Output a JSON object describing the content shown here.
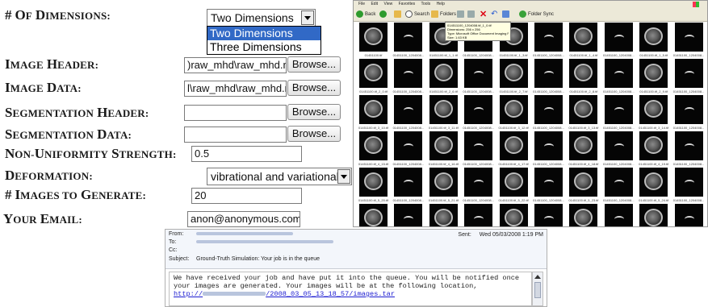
{
  "form": {
    "dimensions": {
      "label": "# of Dimensions:",
      "selected": "Two Dimensions",
      "options": [
        "Two Dimensions",
        "Three Dimensions"
      ]
    },
    "image_header": {
      "label": "Image Header:",
      "value": ")raw_mhd\\raw_mhd.mhd",
      "button": "Browse..."
    },
    "image_data": {
      "label": "Image Data:",
      "value": "l\\raw_mhd\\raw_mhd.raw",
      "button": "Browse..."
    },
    "segmentation_header": {
      "label": "Segmentation Header:",
      "value": "",
      "button": "Browse..."
    },
    "segmentation_data": {
      "label": "Segmentation Data:",
      "value": "",
      "button": "Browse..."
    },
    "non_uniformity": {
      "label": "Non-Uniformity Strength:",
      "value": "0.5"
    },
    "deformation": {
      "label": "Deformation:",
      "selected": "vibrational and variational"
    },
    "num_images": {
      "label": "# Images to Generate:",
      "value": "20"
    },
    "email": {
      "label": "Your Email:",
      "value": "anon@anonymous.com"
    }
  },
  "explorer": {
    "menu": [
      "File",
      "Edit",
      "View",
      "Favorites",
      "Tools",
      "Help"
    ],
    "toolbar": {
      "back": "Back",
      "search": "Search",
      "folders": "Folders",
      "folder_sync": "Folder Sync"
    },
    "tooltip": [
      "014511100_1204008.tif_1_0.tif",
      "Dimensions: 256 x 256",
      "Type: Microsoft Office Document Imaging File",
      "Size: 1.63 KB"
    ],
    "captions": [
      [
        "01451100.tif",
        "01451100_1204008...",
        "01451100.tif_1_1.tif",
        "01451100_1204008...",
        "01451100.tif_1_3.tif",
        "01451100_1204008...",
        "01451100.tif_1_4.tif",
        "01451100_1204008...",
        "01451100.tif_1_5.tif",
        "01451100_1204008..."
      ],
      [
        "01451100.tif_2_0.tif",
        "01451100_1204008...",
        "01451100.tif_2_6.tif",
        "01451100_1204008...",
        "01451100.tif_2_7.tif",
        "01451100_1204008...",
        "01451100.tif_2_8.tif",
        "01451100_1204008...",
        "01451100.tif_2_9.tif",
        "01451100_1204008..."
      ],
      [
        "01451100.tif_3_10.tif",
        "01451100_1204008...",
        "01451100.tif_3_11.tif",
        "01451100_1204008...",
        "01451100.tif_3_12.tif",
        "01451100_1204008...",
        "01451100.tif_3_13.tif",
        "01451100_1204008...",
        "01451100.tif_3_14.tif",
        "01451100_1204008..."
      ],
      [
        "01451100.tif_4_15.tif",
        "01451100_1204008...",
        "01451100.tif_4_16.tif",
        "01451100_1204008...",
        "01451100.tif_4_17.tif",
        "01451100_1204008...",
        "01451100.tif_4_18.tif",
        "01451100_1204008...",
        "01451100.tif_4_19.tif",
        "01451100_1204008..."
      ],
      [
        "01451100.tif_5_20.tif",
        "01451100_1204008...",
        "01451100.tif_5_21.tif",
        "01451100_1204008...",
        "01451100.tif_5_22.tif",
        "01451100_1204008...",
        "01451100.tif_5_23.tif",
        "01451100_1204008...",
        "01451100.tif_5_24.tif",
        "01451100_1204008..."
      ],
      [
        "",
        "",
        "",
        "",
        "",
        "",
        "",
        "",
        "",
        ""
      ]
    ]
  },
  "email": {
    "from_label": "From:",
    "to_label": "To:",
    "cc_label": "Cc:",
    "subject_label": "Subject:",
    "subject": "Ground-Truth Simulation: Your job is in the queue",
    "sent_label": "Sent:",
    "sent": "Wed 05/03/2008 1:19 PM",
    "body_line1": "We have received your job and have put it into the queue. You will be notified once",
    "body_line2": "your images are generated. Your images will be at the following location,",
    "link_prefix": "http://",
    "link_suffix": "/2008_03_05_13_18_57/images.tar"
  }
}
